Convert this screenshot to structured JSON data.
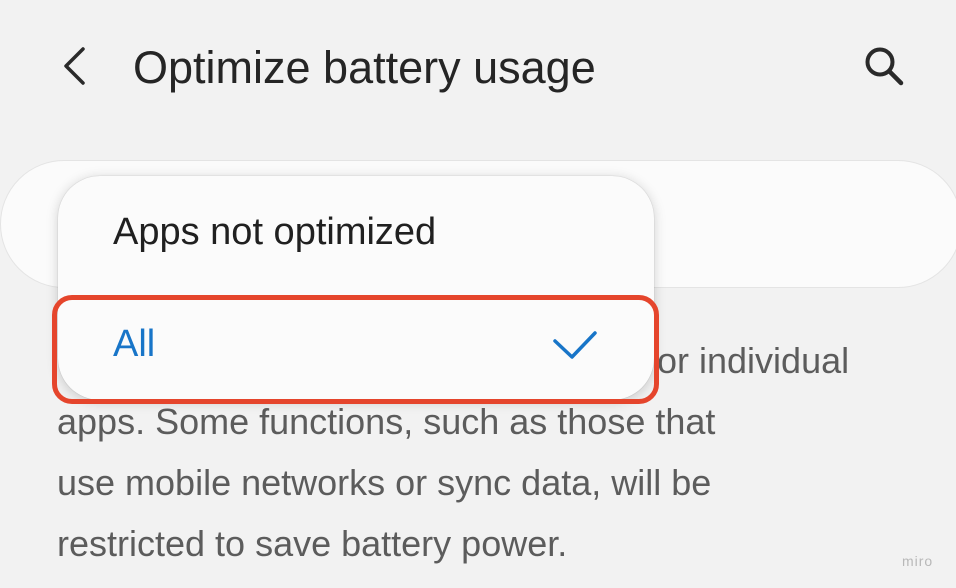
{
  "header": {
    "title": "Optimize battery usage",
    "back_icon": "chevron-left-icon",
    "search_icon": "search-icon"
  },
  "dropdown": {
    "options": [
      {
        "label": "Apps not optimized",
        "selected": false
      },
      {
        "label": "All",
        "selected": true
      }
    ],
    "check_icon": "check-icon"
  },
  "description": {
    "text_lines": [
      "or individual",
      "apps. Some functions, such as those that",
      "use mobile networks or sync data, will be",
      "restricted to save battery power."
    ]
  },
  "watermark": "miro",
  "colors": {
    "accent": "#1875c8",
    "highlight": "#e5452c",
    "background": "#f2f2f2"
  }
}
